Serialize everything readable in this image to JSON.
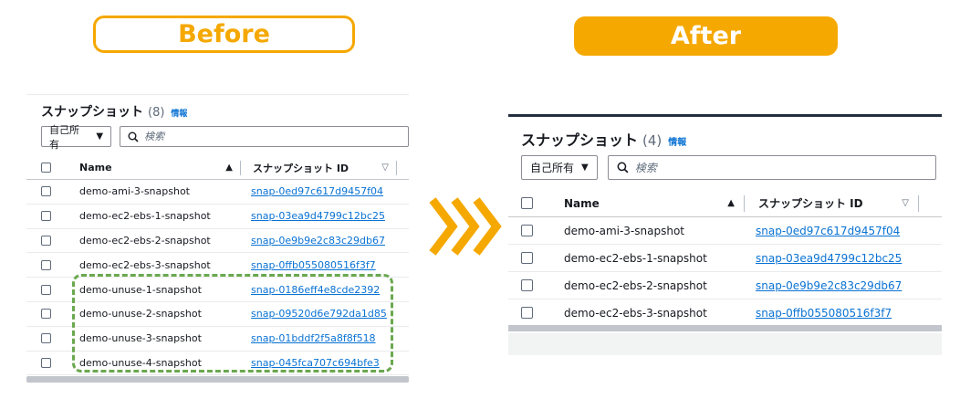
{
  "labels": {
    "before": "Before",
    "after": "After"
  },
  "colors": {
    "accent": "#f5a800",
    "link": "#0972d3",
    "highlight": "#6aa84f"
  },
  "before": {
    "title": "スナップショット",
    "count": "(8)",
    "info": "情報",
    "owner_filter": "自己所有",
    "search_placeholder": "検索",
    "columns": {
      "name": "Name",
      "id": "スナップショット ID"
    },
    "rows": [
      {
        "name": "demo-ami-3-snapshot",
        "id": "snap-0ed97c617d9457f04"
      },
      {
        "name": "demo-ec2-ebs-1-snapshot",
        "id": "snap-03ea9d4799c12bc25"
      },
      {
        "name": "demo-ec2-ebs-2-snapshot",
        "id": "snap-0e9b9e2c83c29db67"
      },
      {
        "name": "demo-ec2-ebs-3-snapshot",
        "id": "snap-0ffb055080516f3f7"
      },
      {
        "name": "demo-unuse-1-snapshot",
        "id": "snap-0186eff4e8cde2392"
      },
      {
        "name": "demo-unuse-2-snapshot",
        "id": "snap-09520d6e792da1d85"
      },
      {
        "name": "demo-unuse-3-snapshot",
        "id": "snap-01bddf2f5a8f8f518"
      },
      {
        "name": "demo-unuse-4-snapshot",
        "id": "snap-045fca707c694bfe3"
      }
    ]
  },
  "after": {
    "title": "スナップショット",
    "count": "(4)",
    "info": "情報",
    "owner_filter": "自己所有",
    "search_placeholder": "検索",
    "columns": {
      "name": "Name",
      "id": "スナップショット ID"
    },
    "rows": [
      {
        "name": "demo-ami-3-snapshot",
        "id": "snap-0ed97c617d9457f04"
      },
      {
        "name": "demo-ec2-ebs-1-snapshot",
        "id": "snap-03ea9d4799c12bc25"
      },
      {
        "name": "demo-ec2-ebs-2-snapshot",
        "id": "snap-0e9b9e2c83c29db67"
      },
      {
        "name": "demo-ec2-ebs-3-snapshot",
        "id": "snap-0ffb055080516f3f7"
      }
    ]
  }
}
